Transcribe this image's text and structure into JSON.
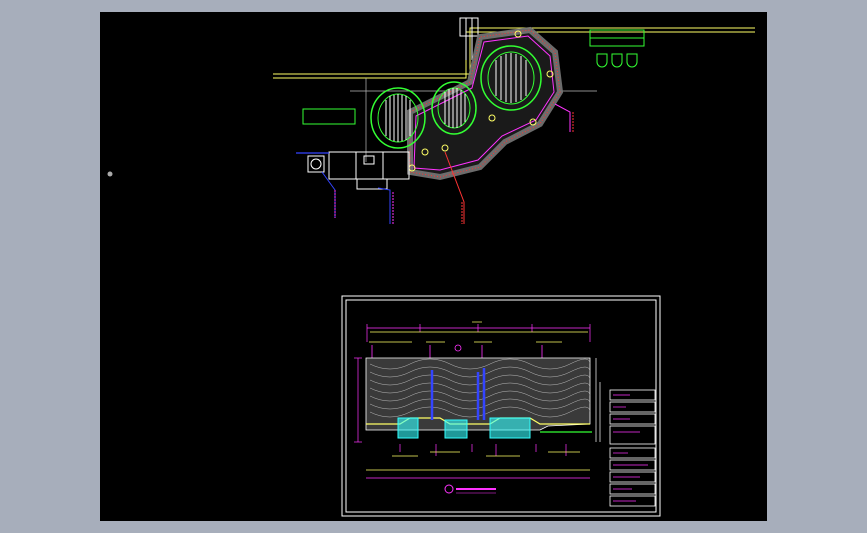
{
  "viewport": {
    "background": "#000000",
    "page_background": "#a7aebb"
  },
  "colors": {
    "yellow": "#ffff66",
    "red": "#ff3333",
    "green": "#33ff33",
    "magenta": "#ff33ff",
    "cyan": "#33ffff",
    "blue": "#3344ff",
    "white": "#ffffff",
    "grey": "#9a9a9a",
    "orange": "#ff9900",
    "pink": "#ff66cc"
  },
  "icons": {
    "cursor": "crosshair-dot-icon"
  }
}
